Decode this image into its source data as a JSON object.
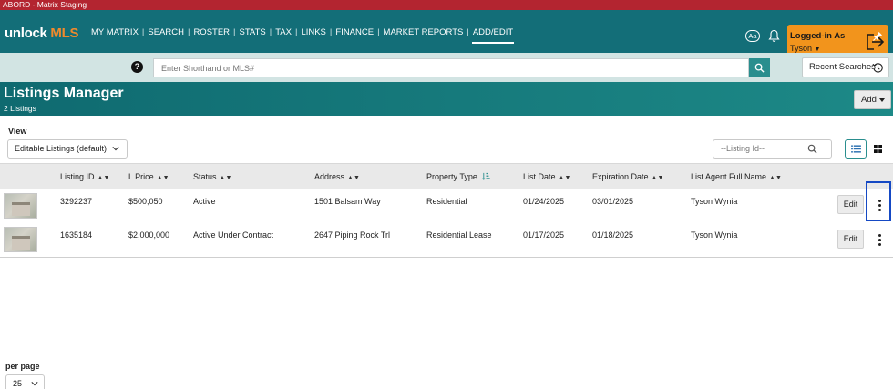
{
  "env_bar": {
    "title": "ABORD - Matrix Staging"
  },
  "header": {
    "logo_part1": "unlock",
    "logo_part2": "MLS",
    "nav": [
      "MY MATRIX",
      "SEARCH",
      "ROSTER",
      "STATS",
      "TAX",
      "LINKS",
      "FINANCE",
      "MARKET REPORTS",
      "ADD/EDIT"
    ],
    "active_nav": "ADD/EDIT",
    "font_size_button": "Aa",
    "login": {
      "label": "Logged-in As",
      "user": "Tyson"
    }
  },
  "search": {
    "help_label": "?",
    "placeholder": "Enter Shorthand or MLS#",
    "recent_label": "Recent Searches"
  },
  "page": {
    "title": "Listings Manager",
    "count": "2 Listings",
    "add_label": "Add"
  },
  "toolbar": {
    "view_label": "View",
    "view_value": "Editable Listings (default)",
    "listing_id_placeholder": "--Listing Id--"
  },
  "table": {
    "columns": [
      "Listing ID",
      "L Price",
      "Status",
      "Address",
      "Property Type",
      "List Date",
      "Expiration Date",
      "List Agent Full Name"
    ],
    "rows": [
      {
        "listing_id": "3292237",
        "price": "$500,050",
        "status": "Active",
        "address": "1501 Balsam Way",
        "property_type": "Residential",
        "list_date": "01/24/2025",
        "expiration_date": "03/01/2025",
        "agent": "Tyson Wynia",
        "edit_label": "Edit"
      },
      {
        "listing_id": "1635184",
        "price": "$2,000,000",
        "status": "Active Under Contract",
        "address": "2647 Piping Rock Trl",
        "property_type": "Residential Lease",
        "list_date": "01/17/2025",
        "expiration_date": "01/18/2025",
        "agent": "Tyson Wynia",
        "edit_label": "Edit"
      }
    ]
  },
  "pagination": {
    "per_page_label": "per page",
    "per_page_value": "25"
  },
  "colors": {
    "env_bar": "#b32530",
    "nav_bg": "#136e78",
    "login_bg": "#f2941c",
    "search_bg": "#d2e4e3",
    "focus_outline": "#1549c4"
  }
}
